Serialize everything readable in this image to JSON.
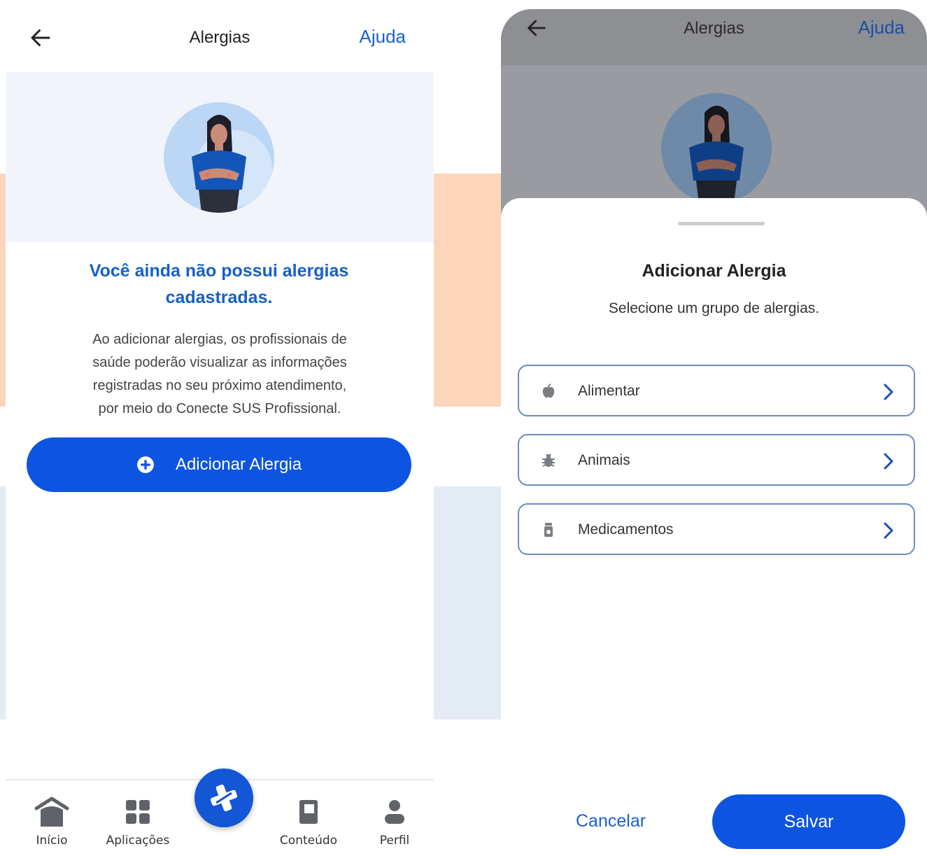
{
  "left_screen": {
    "header": {
      "title": "Alergias",
      "help_label": "Ajuda",
      "back_icon": "arrow-left-icon"
    },
    "empty_state": {
      "title_line1": "Você ainda não possui alergias",
      "title_line2": "cadastradas.",
      "desc_line1": "Ao adicionar alergias, os profissionais de",
      "desc_line2": "saúde poderão visualizar as informações",
      "desc_line3": "registradas no seu próximo atendimento,",
      "desc_line4": "por meio do Conecte SUS Profissional."
    },
    "add_button": {
      "label": "Adicionar Alergia",
      "icon": "plus-circle-icon"
    },
    "tabbar": {
      "items": [
        {
          "label": "Início",
          "icon": "home-icon"
        },
        {
          "label": "Aplicações",
          "icon": "grid-icon"
        },
        {
          "label": "Conteúdo",
          "icon": "book-icon"
        },
        {
          "label": "Perfil",
          "icon": "person-icon"
        }
      ],
      "fab_icon": "health-cross-icon"
    }
  },
  "right_screen": {
    "header": {
      "title": "Alergias",
      "help_label": "Ajuda",
      "back_icon": "arrow-left-icon"
    },
    "sheet": {
      "title": "Adicionar Alergia",
      "subtitle": "Selecione um grupo de alergias.",
      "options": [
        {
          "label": "Alimentar",
          "icon": "apple-icon"
        },
        {
          "label": "Animais",
          "icon": "bug-icon"
        },
        {
          "label": "Medicamentos",
          "icon": "pill-bottle-icon"
        }
      ],
      "cancel_label": "Cancelar",
      "save_label": "Salvar"
    }
  },
  "colors": {
    "primary": "#0d55e0",
    "link": "#1b5fd1",
    "heading_blue": "#1561c7",
    "bg_peach": "#fdd5bb",
    "bg_light_blue": "#e3ebf4",
    "overlay_gray": "#8f9095"
  }
}
